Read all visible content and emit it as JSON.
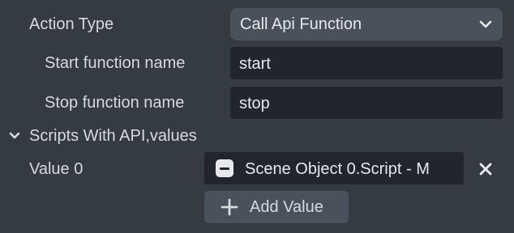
{
  "action_type": {
    "label": "Action Type",
    "selected": "Call Api Function",
    "icon": "chevron-down-icon"
  },
  "start_function": {
    "label": "Start function name",
    "value": "start"
  },
  "stop_function": {
    "label": "Stop function name",
    "value": "stop"
  },
  "scripts_section": {
    "label": "Scripts With API,values",
    "toggle_icon": "chevron-down-icon",
    "items": [
      {
        "label": "Value 0",
        "value": "Scene Object 0.Script - M",
        "icon": "script-component-icon",
        "remove_icon": "close-icon"
      }
    ],
    "add_label": "Add Value",
    "add_icon": "plus-icon"
  },
  "colors": {
    "background": "#363b42",
    "input_background": "#22262c",
    "button_background": "#4a515a",
    "text": "#d6d9de"
  }
}
